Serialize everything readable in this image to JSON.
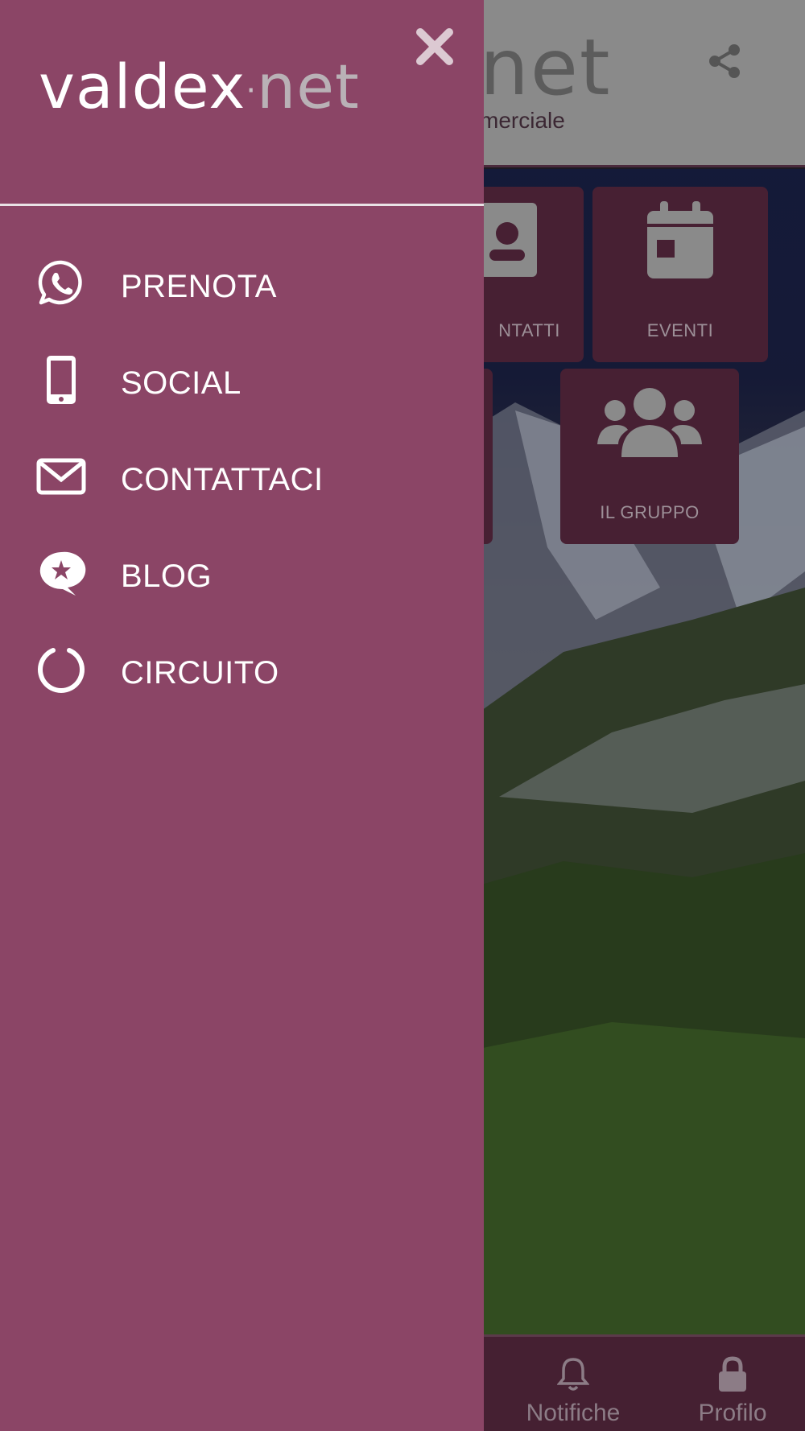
{
  "app": {
    "header": {
      "logo_visible_part": "net",
      "subtitle_visible_part": "merciale"
    },
    "tiles": [
      {
        "id": "contatti",
        "label_visible": "NTATTI",
        "icon": "contact-card-icon"
      },
      {
        "id": "eventi",
        "label": "EVENTI",
        "icon": "calendar-icon"
      },
      {
        "id": "il-gruppo",
        "label": "IL GRUPPO",
        "icon": "group-icon"
      }
    ],
    "bottom_nav": [
      {
        "label": "Notifiche",
        "icon": "bell-icon"
      },
      {
        "label": "Profilo",
        "icon": "lock-icon"
      }
    ]
  },
  "drawer": {
    "brand": {
      "part1": "valdex",
      "dot": "·",
      "part2": "net"
    },
    "close_icon": "close-icon",
    "menu": [
      {
        "label": "PRENOTA",
        "icon": "whatsapp-icon"
      },
      {
        "label": "SOCIAL",
        "icon": "mobile-phone-icon"
      },
      {
        "label": "CONTATTACI",
        "icon": "envelope-icon"
      },
      {
        "label": "BLOG",
        "icon": "star-chat-icon"
      },
      {
        "label": "CIRCUITO",
        "icon": "circle-notch-icon"
      }
    ]
  },
  "colors": {
    "drawer_bg": "#8b4566",
    "tile_bg": "#472033",
    "bottom_bar_bg": "#452032",
    "header_bg": "#8a8a8a"
  }
}
